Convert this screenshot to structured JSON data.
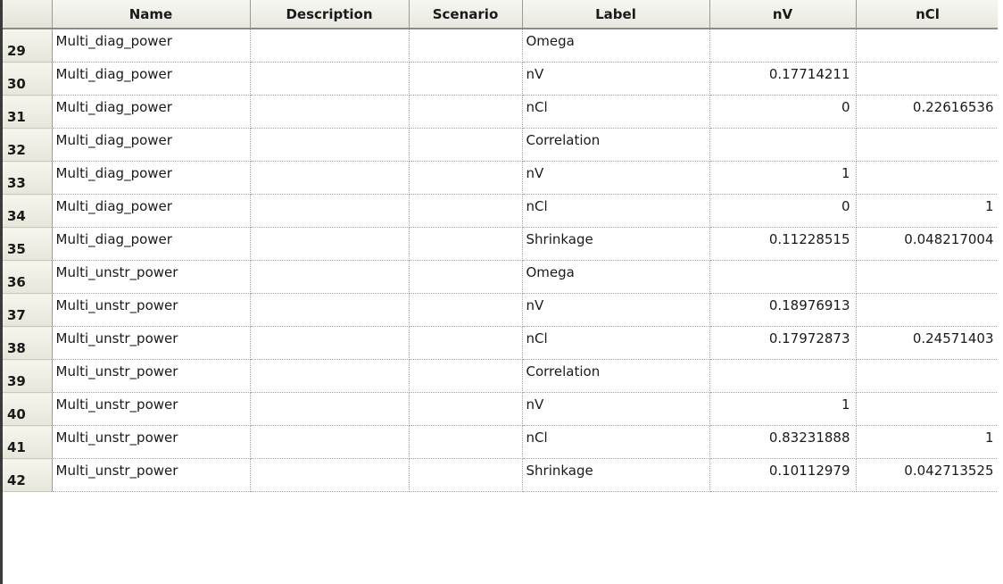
{
  "columns": [
    "",
    "Name",
    "Description",
    "Scenario",
    "Label",
    "nV",
    "nCl"
  ],
  "rows": [
    {
      "num": "29",
      "name": "Multi_diag_power",
      "description": "",
      "scenario": "",
      "label": "Omega",
      "nV": "",
      "nCl": ""
    },
    {
      "num": "30",
      "name": "Multi_diag_power",
      "description": "",
      "scenario": "",
      "label": "nV",
      "nV": "0.17714211",
      "nCl": ""
    },
    {
      "num": "31",
      "name": "Multi_diag_power",
      "description": "",
      "scenario": "",
      "label": "nCl",
      "nV": "0",
      "nCl": "0.22616536"
    },
    {
      "num": "32",
      "name": "Multi_diag_power",
      "description": "",
      "scenario": "",
      "label": "Correlation",
      "nV": "",
      "nCl": ""
    },
    {
      "num": "33",
      "name": "Multi_diag_power",
      "description": "",
      "scenario": "",
      "label": "nV",
      "nV": "1",
      "nCl": ""
    },
    {
      "num": "34",
      "name": "Multi_diag_power",
      "description": "",
      "scenario": "",
      "label": "nCl",
      "nV": "0",
      "nCl": "1"
    },
    {
      "num": "35",
      "name": "Multi_diag_power",
      "description": "",
      "scenario": "",
      "label": "Shrinkage",
      "nV": "0.11228515",
      "nCl": "0.048217004"
    },
    {
      "num": "36",
      "name": "Multi_unstr_power",
      "description": "",
      "scenario": "",
      "label": "Omega",
      "nV": "",
      "nCl": ""
    },
    {
      "num": "37",
      "name": "Multi_unstr_power",
      "description": "",
      "scenario": "",
      "label": "nV",
      "nV": "0.18976913",
      "nCl": ""
    },
    {
      "num": "38",
      "name": "Multi_unstr_power",
      "description": "",
      "scenario": "",
      "label": "nCl",
      "nV": "0.17972873",
      "nCl": "0.24571403"
    },
    {
      "num": "39",
      "name": "Multi_unstr_power",
      "description": "",
      "scenario": "",
      "label": "Correlation",
      "nV": "",
      "nCl": ""
    },
    {
      "num": "40",
      "name": "Multi_unstr_power",
      "description": "",
      "scenario": "",
      "label": "nV",
      "nV": "1",
      "nCl": ""
    },
    {
      "num": "41",
      "name": "Multi_unstr_power",
      "description": "",
      "scenario": "",
      "label": "nCl",
      "nV": "0.83231888",
      "nCl": "1"
    },
    {
      "num": "42",
      "name": "Multi_unstr_power",
      "description": "",
      "scenario": "",
      "label": "Shrinkage",
      "nV": "0.10112979",
      "nCl": "0.042713525"
    }
  ]
}
